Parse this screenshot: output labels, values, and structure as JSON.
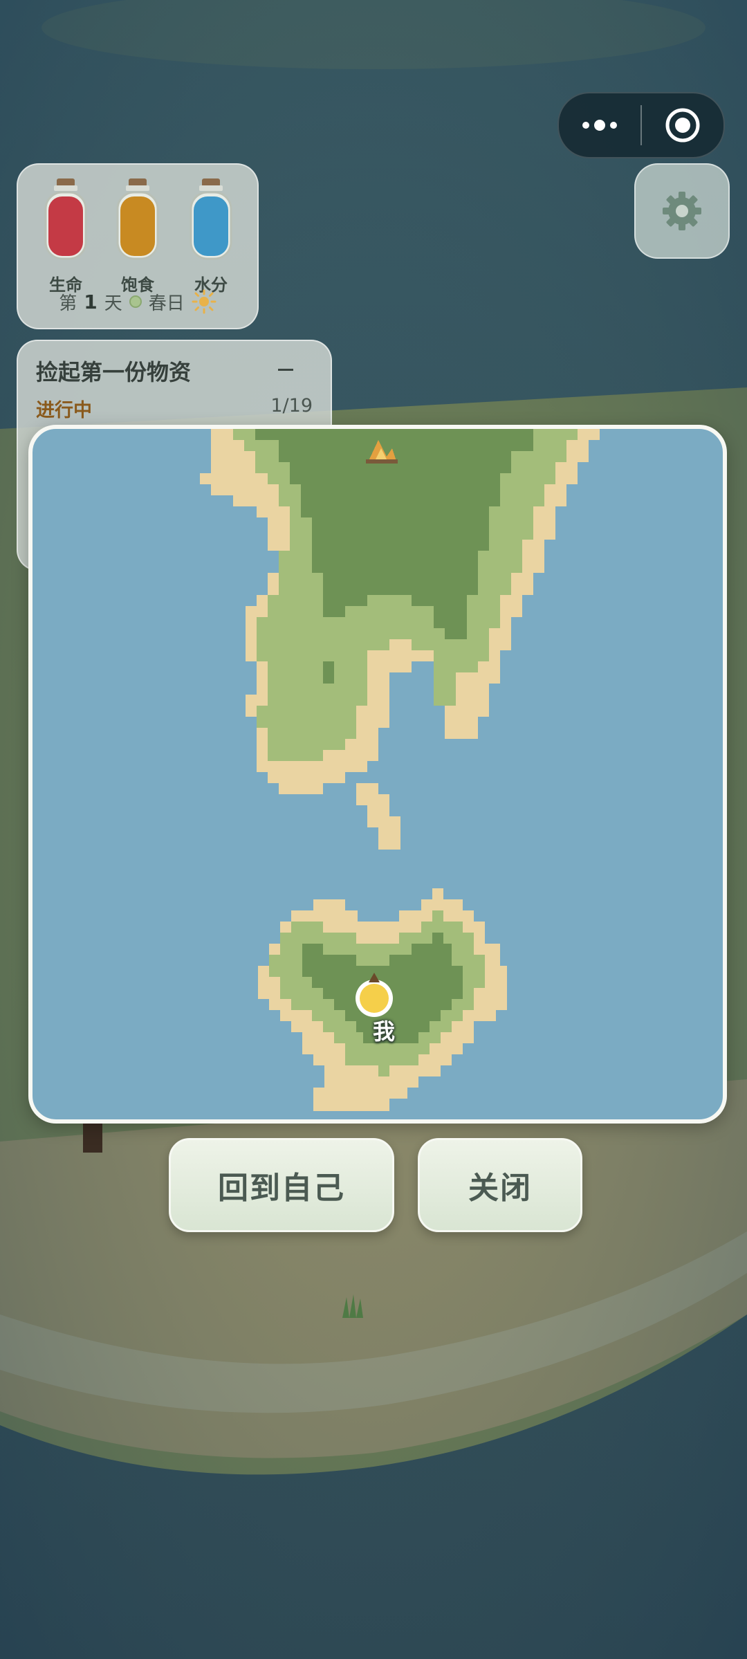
{
  "stats": {
    "health": {
      "label": "生命",
      "color": "#c43a45",
      "level": 0.9
    },
    "hunger": {
      "label": "饱食",
      "color": "#c88a22",
      "level": 0.9
    },
    "water": {
      "label": "水分",
      "color": "#3f98c8",
      "level": 0.9
    }
  },
  "day": {
    "prefix": "第",
    "number": "1",
    "suffix": "天",
    "season": "春日",
    "weather_icon": "sun-icon"
  },
  "quest": {
    "title": "捡起第一份物资",
    "status": "进行中",
    "progress": "1/19"
  },
  "map": {
    "player_label": "我",
    "water_color": "#7babc3",
    "sand_color": "#ead4a2",
    "grass_color": "#a3bd7a",
    "forest_color": "#6e9255"
  },
  "buttons": {
    "home": "回到自己",
    "close": "关闭"
  },
  "icons": {
    "menu": "more-dots-icon",
    "record": "target-icon",
    "settings": "gear-icon",
    "campfire": "campfire-icon"
  }
}
